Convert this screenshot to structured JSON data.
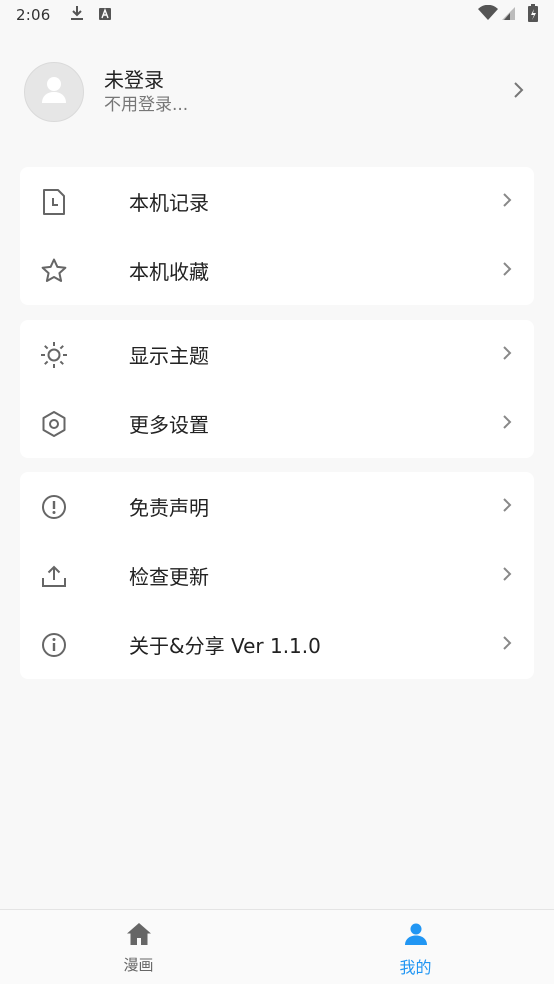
{
  "status_bar": {
    "time": "2:06"
  },
  "profile": {
    "name": "未登录",
    "subtitle": "不用登录..."
  },
  "groups": [
    {
      "items": [
        {
          "label": "本机记录",
          "icon": "history-file-icon"
        },
        {
          "label": "本机收藏",
          "icon": "star-icon"
        }
      ]
    },
    {
      "items": [
        {
          "label": "显示主题",
          "icon": "sun-icon"
        },
        {
          "label": "更多设置",
          "icon": "settings-hexagon-icon"
        }
      ]
    },
    {
      "items": [
        {
          "label": "免责声明",
          "icon": "alert-circle-icon"
        },
        {
          "label": "检查更新",
          "icon": "upload-icon"
        },
        {
          "label": "关于&分享 Ver 1.1.0",
          "icon": "info-icon"
        }
      ]
    }
  ],
  "bottom_nav": {
    "tabs": [
      {
        "label": "漫画",
        "icon": "home-icon"
      },
      {
        "label": "我的",
        "icon": "person-icon"
      }
    ],
    "active_color": "#2196f3"
  }
}
